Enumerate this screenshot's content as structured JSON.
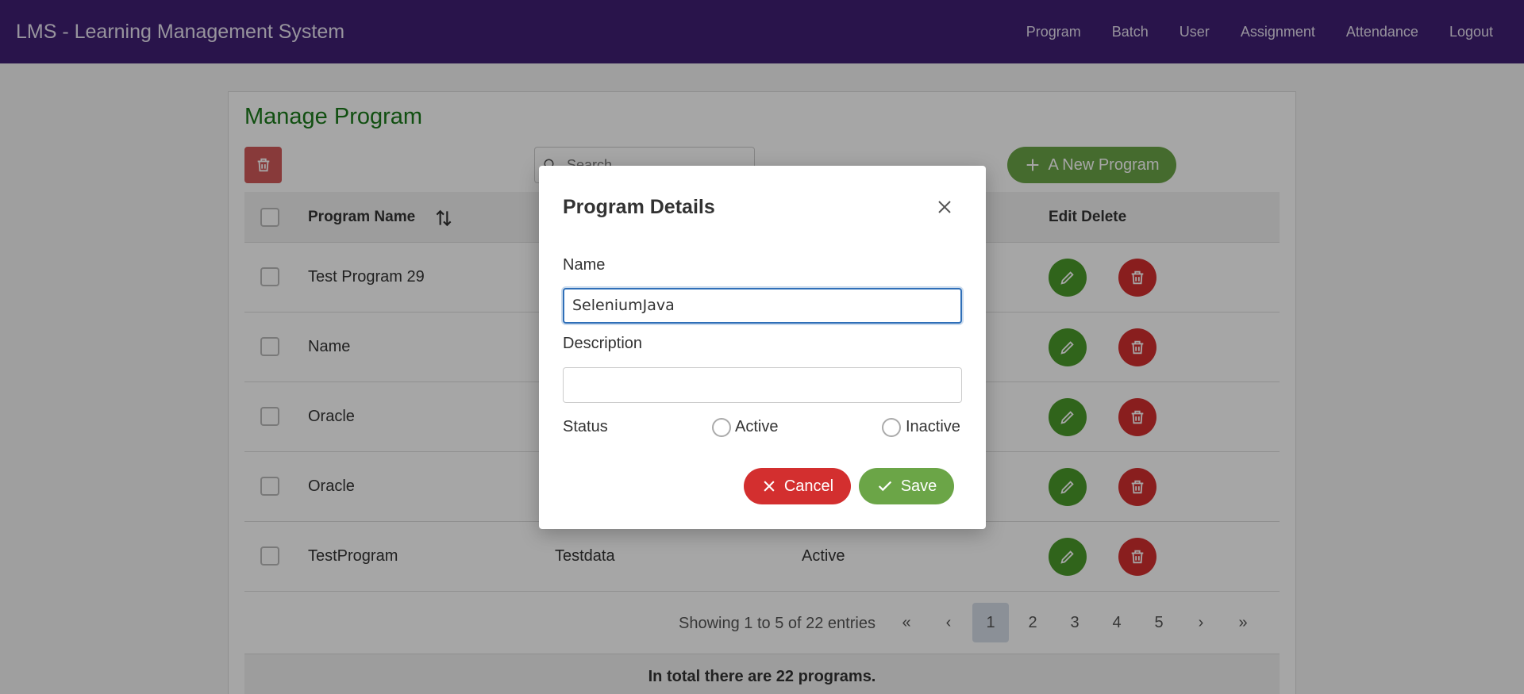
{
  "app": {
    "title": "LMS - Learning Management System"
  },
  "nav": [
    "Program",
    "Batch",
    "User",
    "Assignment",
    "Attendance",
    "Logout"
  ],
  "page": {
    "title": "Manage Program",
    "search_placeholder": "Search",
    "new_button": "A New Program"
  },
  "table": {
    "headers": {
      "name": "Program Name",
      "actions": "Edit Delete"
    },
    "rows": [
      {
        "name": "Test Program 29",
        "description": "",
        "status": ""
      },
      {
        "name": "Name",
        "description": "",
        "status": ""
      },
      {
        "name": "Oracle",
        "description": "",
        "status": ""
      },
      {
        "name": "Oracle",
        "description": "",
        "status": ""
      },
      {
        "name": "TestProgram",
        "description": "Testdata",
        "status": "Active"
      }
    ]
  },
  "pagination": {
    "info": "Showing 1 to 5 of 22 entries",
    "first": "«",
    "prev": "‹",
    "pages": [
      "1",
      "2",
      "3",
      "4",
      "5"
    ],
    "next": "›",
    "last": "»",
    "active_page": "1"
  },
  "footer": {
    "text": "In total there are 22 programs."
  },
  "dialog": {
    "title": "Program Details",
    "name_label": "Name",
    "name_value": "SeleniumJava",
    "description_label": "Description",
    "description_value": "",
    "status_label": "Status",
    "active_label": "Active",
    "inactive_label": "Inactive",
    "cancel_label": "Cancel",
    "save_label": "Save"
  },
  "colors": {
    "header_bg": "#3f1f73",
    "title_green": "#1b7a1b",
    "button_green": "#6ba547",
    "button_red": "#d32f2f"
  },
  "icons": [
    "trash-icon",
    "search-icon",
    "plus-icon",
    "sort-icon",
    "pencil-icon",
    "close-icon",
    "check-icon"
  ]
}
